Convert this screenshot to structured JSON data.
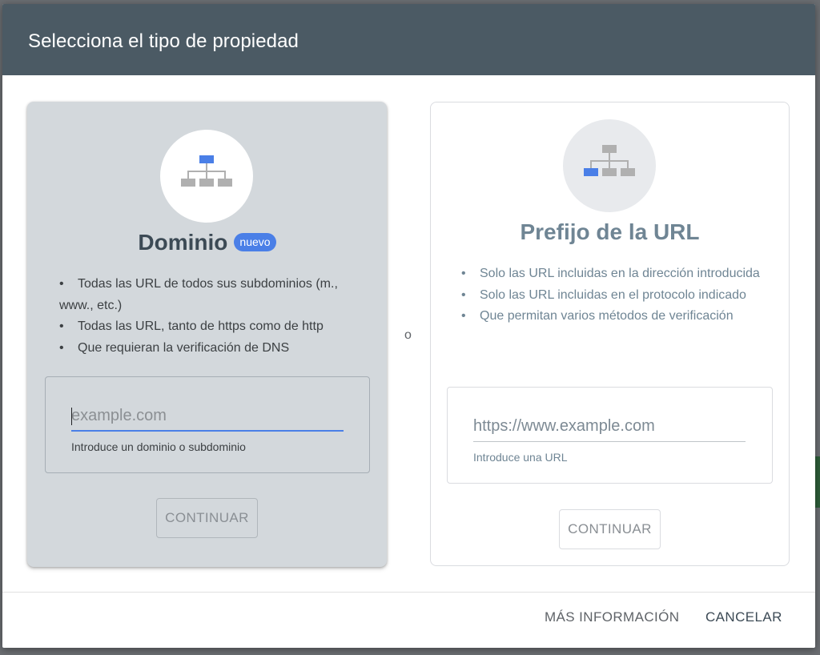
{
  "dialog": {
    "title": "Selecciona el tipo de propiedad",
    "separator": "o"
  },
  "domain_card": {
    "icon": "sitemap-icon",
    "heading": "Dominio",
    "badge": "nuevo",
    "bullets": [
      "Todas las URL de todos sus subdominios (m., www., etc.)",
      "Todas las URL, tanto de https como de http",
      "Que requieran la verificación de DNS"
    ],
    "input_value": "",
    "input_placeholder": "example.com",
    "hint": "Introduce un dominio o subdominio",
    "continue_label": "CONTINUAR"
  },
  "url_card": {
    "icon": "sitemap-icon",
    "heading": "Prefijo de la URL",
    "bullets": [
      "Solo las URL incluidas en la dirección introducida",
      "Solo las URL incluidas en el protocolo indicado",
      "Que permitan varios métodos de verificación"
    ],
    "input_value": "",
    "input_placeholder": "https://www.example.com",
    "hint": "Introduce una URL",
    "continue_label": "CONTINUAR"
  },
  "footer": {
    "more_info_label": "MÁS INFORMACIÓN",
    "cancel_label": "CANCELAR"
  },
  "colors": {
    "header": "#4b5a64",
    "accent": "#4a7fe7",
    "selected_card": "#d3d8dc"
  }
}
